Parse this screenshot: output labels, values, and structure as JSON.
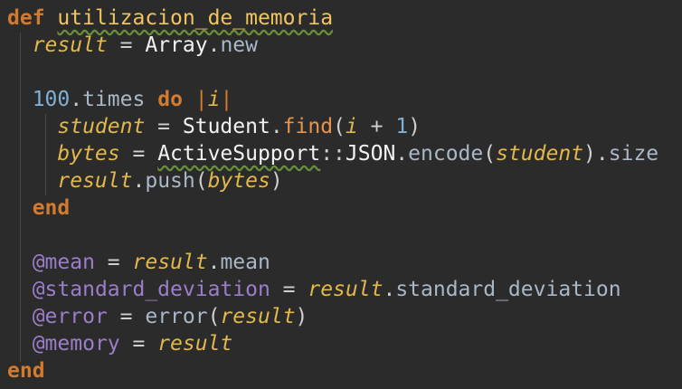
{
  "code": {
    "lines": [
      [
        {
          "t": "def",
          "c": "kw"
        },
        {
          "t": " ",
          "c": "plain"
        },
        {
          "t": "utilizacion_de_memoria",
          "c": "def-name"
        }
      ],
      [
        {
          "t": "  ",
          "c": "plain"
        },
        {
          "t": "result",
          "c": "local"
        },
        {
          "t": " = ",
          "c": "op"
        },
        {
          "t": "Array",
          "c": "const"
        },
        {
          "t": ".",
          "c": "punct"
        },
        {
          "t": "new",
          "c": "method"
        }
      ],
      [],
      [
        {
          "t": "  ",
          "c": "plain"
        },
        {
          "t": "100",
          "c": "num"
        },
        {
          "t": ".",
          "c": "punct"
        },
        {
          "t": "times",
          "c": "method"
        },
        {
          "t": " ",
          "c": "plain"
        },
        {
          "t": "do",
          "c": "kw"
        },
        {
          "t": " ",
          "c": "plain"
        },
        {
          "t": "|",
          "c": "pipe"
        },
        {
          "t": "i",
          "c": "local"
        },
        {
          "t": "|",
          "c": "pipe"
        }
      ],
      [
        {
          "t": "    ",
          "c": "plain"
        },
        {
          "t": "student",
          "c": "local"
        },
        {
          "t": " = ",
          "c": "op"
        },
        {
          "t": "Student",
          "c": "const"
        },
        {
          "t": ".",
          "c": "punct"
        },
        {
          "t": "find",
          "c": "find"
        },
        {
          "t": "(",
          "c": "punct"
        },
        {
          "t": "i",
          "c": "local"
        },
        {
          "t": " + ",
          "c": "op"
        },
        {
          "t": "1",
          "c": "num"
        },
        {
          "t": ")",
          "c": "punct"
        }
      ],
      [
        {
          "t": "    ",
          "c": "plain"
        },
        {
          "t": "bytes",
          "c": "local"
        },
        {
          "t": " = ",
          "c": "op"
        },
        {
          "t": "ActiveSupport",
          "c": "const-squiggle"
        },
        {
          "t": "::",
          "c": "punct"
        },
        {
          "t": "JSON",
          "c": "const"
        },
        {
          "t": ".",
          "c": "punct"
        },
        {
          "t": "encode",
          "c": "method"
        },
        {
          "t": "(",
          "c": "punct"
        },
        {
          "t": "student",
          "c": "local"
        },
        {
          "t": ").",
          "c": "punct"
        },
        {
          "t": "size",
          "c": "method"
        }
      ],
      [
        {
          "t": "    ",
          "c": "plain"
        },
        {
          "t": "result",
          "c": "local"
        },
        {
          "t": ".",
          "c": "punct"
        },
        {
          "t": "push",
          "c": "method"
        },
        {
          "t": "(",
          "c": "punct"
        },
        {
          "t": "bytes",
          "c": "local"
        },
        {
          "t": ")",
          "c": "punct"
        }
      ],
      [
        {
          "t": "  ",
          "c": "plain"
        },
        {
          "t": "end",
          "c": "kw"
        }
      ],
      [],
      [
        {
          "t": "  ",
          "c": "plain"
        },
        {
          "t": "@mean",
          "c": "ivar"
        },
        {
          "t": " = ",
          "c": "op"
        },
        {
          "t": "result",
          "c": "local"
        },
        {
          "t": ".",
          "c": "punct"
        },
        {
          "t": "mean",
          "c": "method"
        }
      ],
      [
        {
          "t": "  ",
          "c": "plain"
        },
        {
          "t": "@standard_deviation",
          "c": "ivar"
        },
        {
          "t": " = ",
          "c": "op"
        },
        {
          "t": "result",
          "c": "local"
        },
        {
          "t": ".",
          "c": "punct"
        },
        {
          "t": "standard_deviation",
          "c": "method"
        }
      ],
      [
        {
          "t": "  ",
          "c": "plain"
        },
        {
          "t": "@error",
          "c": "ivar"
        },
        {
          "t": " = ",
          "c": "op"
        },
        {
          "t": "error",
          "c": "method"
        },
        {
          "t": "(",
          "c": "punct"
        },
        {
          "t": "result",
          "c": "local"
        },
        {
          "t": ")",
          "c": "punct"
        }
      ],
      [
        {
          "t": "  ",
          "c": "plain"
        },
        {
          "t": "@memory",
          "c": "ivar"
        },
        {
          "t": " = ",
          "c": "op"
        },
        {
          "t": "result",
          "c": "local"
        }
      ],
      [
        {
          "t": "end",
          "c": "kw"
        }
      ]
    ]
  }
}
